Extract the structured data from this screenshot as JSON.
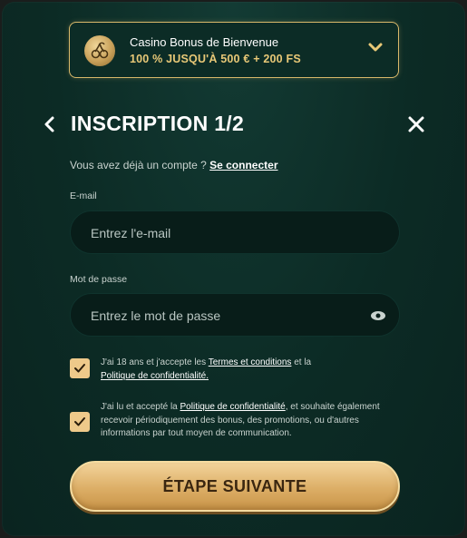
{
  "bonus": {
    "title": "Casino Bonus de Bienvenue",
    "subtitle": "100 % JUSQU'À 500 € + 200 FS",
    "icon": "cherry-icon"
  },
  "header": {
    "title": "INSCRIPTION 1/2",
    "back_icon": "chevron-left-icon",
    "close_icon": "close-icon"
  },
  "login_prompt": {
    "text": "Vous avez déjà un compte ?",
    "link": "Se connecter"
  },
  "email": {
    "label": "E-mail",
    "placeholder": "Entrez l'e-mail",
    "value": ""
  },
  "password": {
    "label": "Mot de passe",
    "placeholder": "Entrez le mot de passe",
    "value": ""
  },
  "consents": [
    {
      "checked": true,
      "text_1": "J'ai 18 ans et j'accepte les ",
      "link_1": "Termes et conditions",
      "text_2": " et la ",
      "link_2": "Politique de confidentialité."
    },
    {
      "checked": true,
      "text_1": "J'ai lu et accepté la ",
      "link_1": "Politique de confidentialité",
      "text_2": ", et souhaite également recevoir périodiquement des bonus, des promotions, ou d'autres informations par tout moyen de communication."
    }
  ],
  "submit_label": "ÉTAPE SUIVANTE",
  "colors": {
    "accent_gold": "#e8c877",
    "background": "#0c2b25",
    "checkbox": "#eec98a"
  }
}
